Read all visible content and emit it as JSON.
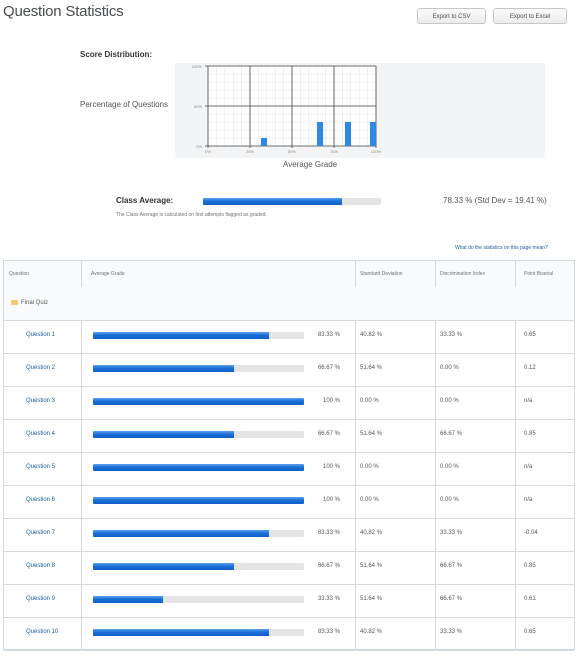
{
  "page": {
    "title": "Question Statistics",
    "export_csv": "Export to CSV",
    "export_excel": "Export to Excel"
  },
  "distribution": {
    "label": "Score Distribution:",
    "ylabel": "Percentage of Questions",
    "xlabel": "Average Grade",
    "y_ticks": [
      "100%",
      "50%",
      "0%"
    ],
    "x_ticks": [
      "0%",
      "25%",
      "50%",
      "75%",
      "100%"
    ]
  },
  "chart_data": {
    "type": "bar",
    "title": "Score Distribution:",
    "xlabel": "Average Grade",
    "ylabel": "Percentage of Questions",
    "x": [
      33.33,
      66.67,
      83.33,
      100
    ],
    "values": [
      10,
      30,
      30,
      30
    ],
    "xlim": [
      0,
      100
    ],
    "ylim": [
      0,
      100
    ],
    "x_tick_labels": [
      "0%",
      "25%",
      "50%",
      "75%",
      "100%"
    ],
    "y_tick_labels": [
      "0%",
      "50%",
      "100%"
    ],
    "grid": true,
    "bar_color": "#2b8ae6"
  },
  "class_average": {
    "label": "Class Average:",
    "value": 78.33,
    "value_text": "78.33 % (Std Dev = 19.41 %)",
    "note": "The Class Average is calculated on first attempts flagged as graded."
  },
  "help_link": "What do the statistics on this page mean?",
  "table": {
    "headers": [
      "Question",
      "Average Grade",
      "Standard Deviation",
      "Discrimination Index",
      "Point Biserial"
    ],
    "group_label": "Final Quiz",
    "rows": [
      {
        "question": "Question 1",
        "avg": 83.33,
        "avg_text": "83.33 %",
        "std": "40.82 %",
        "disc": "33.33 %",
        "pb": "0.65"
      },
      {
        "question": "Question 2",
        "avg": 66.67,
        "avg_text": "66.67 %",
        "std": "51.64 %",
        "disc": "0.00 %",
        "pb": "0.12"
      },
      {
        "question": "Question 3",
        "avg": 100,
        "avg_text": "100 %",
        "std": "0.00 %",
        "disc": "0.00 %",
        "pb": "n/a"
      },
      {
        "question": "Question 4",
        "avg": 66.67,
        "avg_text": "66.67 %",
        "std": "51.64 %",
        "disc": "66.67 %",
        "pb": "0.85"
      },
      {
        "question": "Question 5",
        "avg": 100,
        "avg_text": "100 %",
        "std": "0.00 %",
        "disc": "0.00 %",
        "pb": "n/a"
      },
      {
        "question": "Question 6",
        "avg": 100,
        "avg_text": "100 %",
        "std": "0.00 %",
        "disc": "0.00 %",
        "pb": "n/a"
      },
      {
        "question": "Question 7",
        "avg": 83.33,
        "avg_text": "83.33 %",
        "std": "40.82 %",
        "disc": "33.33 %",
        "pb": "-0.04"
      },
      {
        "question": "Question 8",
        "avg": 66.67,
        "avg_text": "66.67 %",
        "std": "51.64 %",
        "disc": "66.67 %",
        "pb": "0.85"
      },
      {
        "question": "Question 9",
        "avg": 33.33,
        "avg_text": "33.33 %",
        "std": "51.64 %",
        "disc": "66.67 %",
        "pb": "0.61"
      },
      {
        "question": "Question 10",
        "avg": 83.33,
        "avg_text": "83.33 %",
        "std": "40.82 %",
        "disc": "33.33 %",
        "pb": "0.65"
      }
    ]
  }
}
